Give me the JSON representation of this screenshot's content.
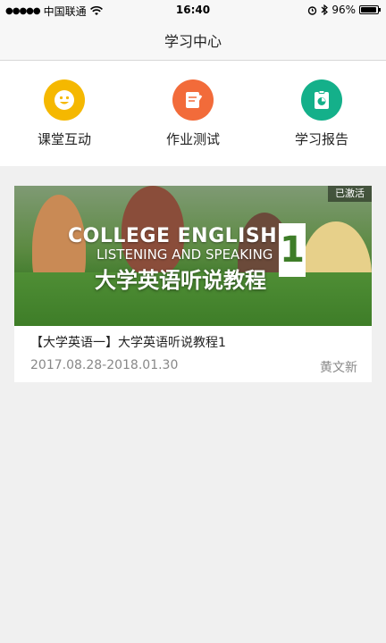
{
  "status_bar": {
    "signal_dots": "●●●●●",
    "carrier": "中国联通",
    "time": "16:40",
    "battery_text": "96%",
    "battery_level": 0.96
  },
  "nav": {
    "title": "学习中心"
  },
  "menu": [
    {
      "label": "课堂互动",
      "icon": "smile-icon",
      "color": "#f5b800"
    },
    {
      "label": "作业测试",
      "icon": "homework-icon",
      "color": "#f26b3a"
    },
    {
      "label": "学习报告",
      "icon": "report-icon",
      "color": "#14b08a"
    }
  ],
  "course": {
    "badge": "已激活",
    "cover_line1": "COLLEGE ENGLISH",
    "cover_line2": "LISTENING AND SPEAKING",
    "cover_line3": "大学英语听说教程",
    "cover_number": "1",
    "title": "【大学英语一】大学英语听说教程1",
    "dates": "2017.08.28-2018.01.30",
    "teacher": "黄文新"
  }
}
